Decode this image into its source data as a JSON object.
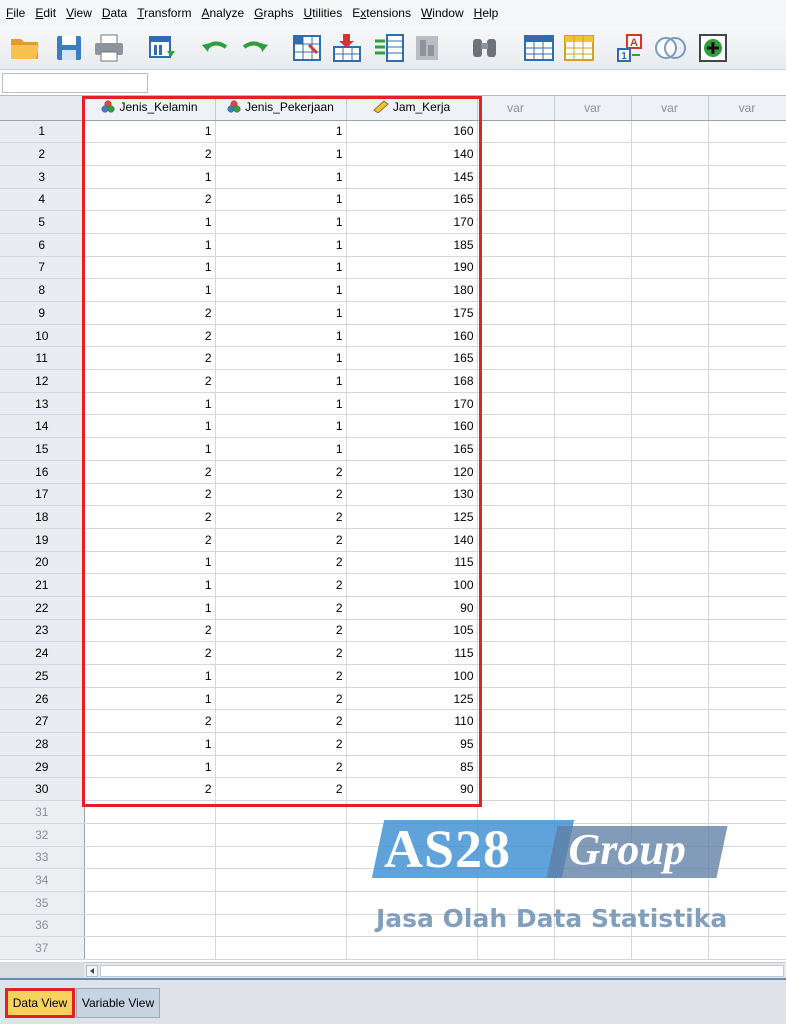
{
  "menu": {
    "items": [
      {
        "mn": "F",
        "rest": "ile"
      },
      {
        "mn": "E",
        "rest": "dit"
      },
      {
        "mn": "V",
        "rest": "iew"
      },
      {
        "mn": "D",
        "rest": "ata"
      },
      {
        "mn": "T",
        "rest": "ransform"
      },
      {
        "mn": "A",
        "rest": "nalyze"
      },
      {
        "mn": "G",
        "rest": "raphs"
      },
      {
        "mn": "U",
        "rest": "tilities"
      },
      {
        "mn": "x",
        "pre": "E",
        "rest": "tensions"
      },
      {
        "mn": "W",
        "rest": "indow"
      },
      {
        "mn": "H",
        "rest": "elp"
      }
    ]
  },
  "toolbar": {
    "icons": [
      "open-folder-icon",
      "save-icon",
      "print-icon",
      "recall-dialog-icon",
      "undo-icon",
      "redo-icon",
      "goto-case-icon",
      "goto-variable-icon",
      "variables-icon",
      "run-descriptives-icon",
      "find-icon",
      "insert-cases-icon",
      "insert-variable-icon",
      "split-file-icon",
      "select-cases-icon",
      "value-labels-icon",
      "use-sets-icon"
    ],
    "colors": {
      "folder": "#f2a93b",
      "save": "#3b7dc4",
      "arrow_green": "#2e9e3e",
      "arrow_red": "#d8342c",
      "accent_blue": "#2f6db3"
    }
  },
  "cell_editor": {
    "reference": "",
    "value": ""
  },
  "grid": {
    "columns": [
      {
        "name": "Jenis_Kelamin",
        "type": "nominal"
      },
      {
        "name": "Jenis_Pekerjaan",
        "type": "nominal"
      },
      {
        "name": "Jam_Kerja",
        "type": "scale"
      },
      {
        "name": "var",
        "type": "empty"
      },
      {
        "name": "var",
        "type": "empty"
      },
      {
        "name": "var",
        "type": "empty"
      },
      {
        "name": "var",
        "type": "empty"
      }
    ],
    "rows": [
      [
        "1",
        "1",
        "160"
      ],
      [
        "2",
        "1",
        "140"
      ],
      [
        "1",
        "1",
        "145"
      ],
      [
        "2",
        "1",
        "165"
      ],
      [
        "1",
        "1",
        "170"
      ],
      [
        "1",
        "1",
        "185"
      ],
      [
        "1",
        "1",
        "190"
      ],
      [
        "1",
        "1",
        "180"
      ],
      [
        "2",
        "1",
        "175"
      ],
      [
        "2",
        "1",
        "160"
      ],
      [
        "2",
        "1",
        "165"
      ],
      [
        "2",
        "1",
        "168"
      ],
      [
        "1",
        "1",
        "170"
      ],
      [
        "1",
        "1",
        "160"
      ],
      [
        "1",
        "1",
        "165"
      ],
      [
        "2",
        "2",
        "120"
      ],
      [
        "2",
        "2",
        "130"
      ],
      [
        "2",
        "2",
        "125"
      ],
      [
        "2",
        "2",
        "140"
      ],
      [
        "1",
        "2",
        "115"
      ],
      [
        "1",
        "2",
        "100"
      ],
      [
        "1",
        "2",
        "90"
      ],
      [
        "2",
        "2",
        "105"
      ],
      [
        "2",
        "2",
        "115"
      ],
      [
        "1",
        "2",
        "100"
      ],
      [
        "1",
        "2",
        "125"
      ],
      [
        "2",
        "2",
        "110"
      ],
      [
        "1",
        "2",
        "95"
      ],
      [
        "1",
        "2",
        "85"
      ],
      [
        "2",
        "2",
        "90"
      ]
    ],
    "empty_row_count": 7,
    "colors": {
      "highlight": "#e41f26",
      "grid_line": "#d4d8de",
      "header_bg": "#eef1f5"
    }
  },
  "watermark": {
    "brand": "AS28",
    "brand_script": "Group",
    "tagline": "Jasa Olah Data Statistika",
    "colors": {
      "brand_bg": "#3c8fd2",
      "script_bg": "#5f7fa6",
      "tagline": "#6d8fb3"
    }
  },
  "tabs": {
    "data_view": "Data View",
    "variable_view": "Variable View",
    "active": "data_view",
    "colors": {
      "active_bg": "#f7d25c",
      "inactive_bg": "#c6d3e3"
    }
  }
}
